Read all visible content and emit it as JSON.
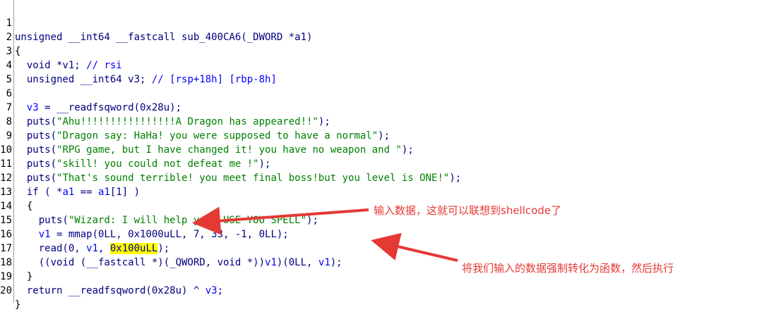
{
  "line_numbers": [
    "1",
    "2",
    "3",
    "4",
    "5",
    "6",
    "7",
    "8",
    "9",
    "10",
    "11",
    "12",
    "13",
    "14",
    "15",
    "16",
    "17",
    "18",
    "19",
    "20"
  ],
  "code": {
    "l1": {
      "decl": "unsigned __int64 __fastcall sub_400CA6(_DWORD *a1)"
    },
    "l2": {
      "text": "{"
    },
    "l3": {
      "decl": "  void *v1; ",
      "comment": "// rsi"
    },
    "l4": {
      "decl": "  unsigned __int64 v3; ",
      "comment": "// [rsp+18h] [rbp-8h]"
    },
    "l5": {
      "text": ""
    },
    "l6": {
      "var": "  v3",
      "rest": " = __readfsqword(0x28u);"
    },
    "l7": {
      "pre": "  puts(",
      "str": "\"Ahu!!!!!!!!!!!!!!!!A Dragon has appeared!!\"",
      "post": ");"
    },
    "l8": {
      "pre": "  puts(",
      "str": "\"Dragon say: HaHa! you were supposed to have a normal\"",
      "post": ");"
    },
    "l9": {
      "pre": "  puts(",
      "str": "\"RPG game, but I have changed it! you have no weapon and \"",
      "post": ");"
    },
    "l10": {
      "pre": "  puts(",
      "str": "\"skill! you could not defeat me !\"",
      "post": ");"
    },
    "l11": {
      "pre": "  puts(",
      "str": "\"That's sound terrible! you meet final boss!but you level is ONE!\"",
      "post": ");"
    },
    "l12": {
      "pre": "  if ( *",
      "v1": "a1",
      "mid": " == ",
      "v2": "a1",
      "post": "[1] )"
    },
    "l13": {
      "text": "  {"
    },
    "l14": {
      "pre": "    puts(",
      "str": "\"Wizard: I will help you! USE YOU SPELL\"",
      "post": ");"
    },
    "l15": {
      "var": "    v1",
      "rest": " = mmap(0LL, 0x1000uLL, 7, 33, -1, 0LL);"
    },
    "l16": {
      "pre": "    read(0, ",
      "var": "v1",
      "mid": ", ",
      "hl": "0x100uLL",
      "post": ");"
    },
    "l17": {
      "pre": "    ((void (__fastcall *)(_QWORD, void *))",
      "v1": "v1",
      "mid": ")(0LL, ",
      "v2": "v1",
      "post": ");"
    },
    "l18": {
      "text": "  }"
    },
    "l19": {
      "pre": "  return __readfsqword(0x28u) ^ ",
      "var": "v3",
      "post": ";"
    },
    "l20": {
      "text": "}"
    }
  },
  "annotations": {
    "a1": "输入数据，这就可以联想到shellcode了",
    "a2": "将我们输入的数据强制转化为函数，然后执行"
  },
  "colors": {
    "keyword": "#000080",
    "string": "#008000",
    "variable": "#0000ff",
    "highlight": "#ffff00",
    "annotation": "#e53935"
  }
}
